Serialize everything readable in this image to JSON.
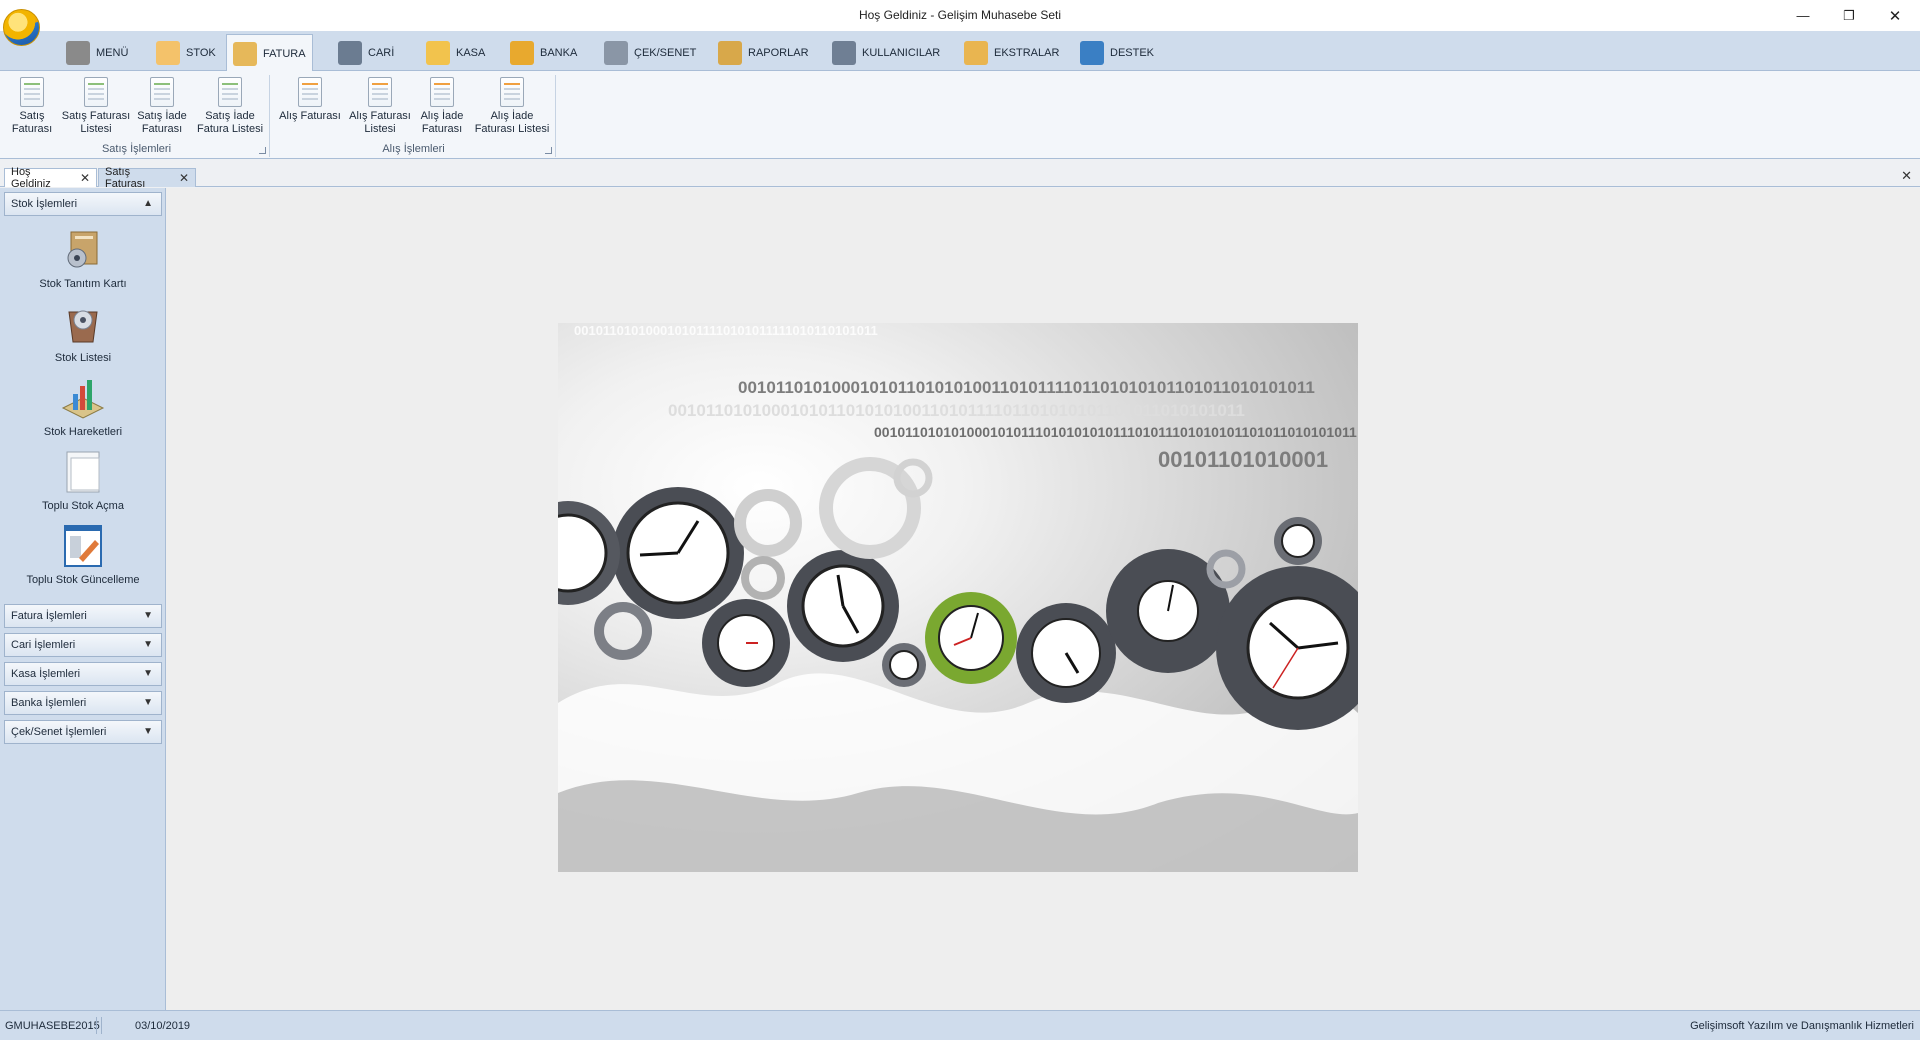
{
  "window": {
    "title": "Hoş Geldiniz - Gelişim Muhasebe Seti"
  },
  "ribbon": {
    "tabs": [
      {
        "label": "MENÜ",
        "icon": "home-icon",
        "color": "#8a8a8a"
      },
      {
        "label": "STOK",
        "icon": "stock-box-icon",
        "color": "#f4c26a"
      },
      {
        "label": "FATURA",
        "icon": "invoice-icon",
        "color": "#e6b85a",
        "active": true
      },
      {
        "label": "CARİ",
        "icon": "id-card-icon",
        "color": "#6b7c91"
      },
      {
        "label": "KASA",
        "icon": "cash-box-icon",
        "color": "#f2c34d"
      },
      {
        "label": "BANKA",
        "icon": "bank-coin-icon",
        "color": "#e8a92e"
      },
      {
        "label": "ÇEK/SENET",
        "icon": "cheque-icon",
        "color": "#8a96a6"
      },
      {
        "label": "RAPORLAR",
        "icon": "clipboard-icon",
        "color": "#d8a84a"
      },
      {
        "label": "KULLANICILAR",
        "icon": "users-gear-icon",
        "color": "#6f7f94"
      },
      {
        "label": "EKSTRALAR",
        "icon": "folder-gear-icon",
        "color": "#e9b550"
      },
      {
        "label": "DESTEK",
        "icon": "tag-icon",
        "color": "#3a7fc4"
      }
    ],
    "groups": [
      {
        "label": "Satış İşlemleri",
        "buttons": [
          {
            "line1": "Satış",
            "line2": "Faturası"
          },
          {
            "line1": "Satış Faturası",
            "line2": "Listesi"
          },
          {
            "line1": "Satış İade",
            "line2": "Faturası"
          },
          {
            "line1": "Satış İade",
            "line2": "Fatura Listesi"
          }
        ]
      },
      {
        "label": "Alış İşlemleri",
        "buttons": [
          {
            "line1": "Alış Faturası",
            "line2": ""
          },
          {
            "line1": "Alış Faturası",
            "line2": "Listesi"
          },
          {
            "line1": "Alış İade",
            "line2": "Faturası"
          },
          {
            "line1": "Alış İade",
            "line2": "Faturası Listesi"
          }
        ]
      }
    ]
  },
  "doc_tabs": [
    {
      "label": "Hoş Geldiniz",
      "active": true
    },
    {
      "label": "Satış Faturası",
      "active": false
    }
  ],
  "sidebar": {
    "expanded_group": "Stok İşlemleri",
    "items": [
      {
        "label": "Stok Tanıtım Kartı",
        "icon": "stock-card-icon"
      },
      {
        "label": "Stok Listesi",
        "icon": "stock-list-icon"
      },
      {
        "label": "Stok Hareketleri",
        "icon": "stock-movements-icon"
      },
      {
        "label": "Toplu Stok Açma",
        "icon": "bulk-open-icon"
      },
      {
        "label": "Toplu Stok Güncelleme",
        "icon": "bulk-update-icon"
      }
    ],
    "collapsed_groups": [
      "Fatura İşlemleri",
      "Cari İşlemleri",
      "Kasa İşlemleri",
      "Banka İşlemleri",
      "Çek/Senet İşlemleri"
    ]
  },
  "hero": {
    "binary_lines": [
      "0010110101000101011110101011111010110101011",
      "00101101010001010110101010011010111101101010101101011010101011",
      "001011010101000101011101010101011101011101010101101011010101011",
      "00101101010001010110101010011010111101101010101101011010101011",
      "00101101010001"
    ]
  },
  "status": {
    "database": "GMUHASEBE2015",
    "date": "03/10/2019",
    "company": "Gelişimsoft Yazılım ve Danışmanlık Hizmetleri"
  }
}
